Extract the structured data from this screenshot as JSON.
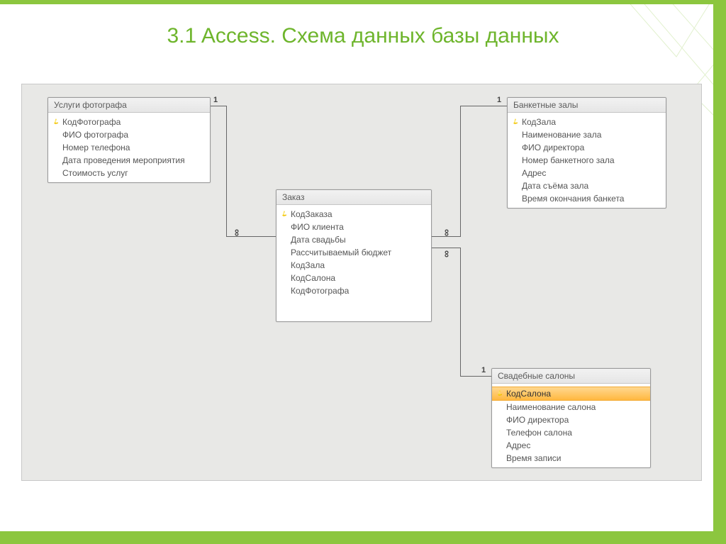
{
  "page_title": "3.1 Access. Схема данных базы данных",
  "tables": {
    "photog": {
      "title": "Услуги фотографа",
      "fields": [
        {
          "label": "КодФотографа",
          "pk": true
        },
        {
          "label": "ФИО фотографа"
        },
        {
          "label": "Номер телефона"
        },
        {
          "label": "Дата проведения мероприятия"
        },
        {
          "label": "Стоимость услуг"
        }
      ]
    },
    "order": {
      "title": "Заказ",
      "fields": [
        {
          "label": "КодЗаказа",
          "pk": true
        },
        {
          "label": "ФИО клиента"
        },
        {
          "label": "Дата свадьбы"
        },
        {
          "label": "Рассчитываемый бюджет"
        },
        {
          "label": "КодЗала"
        },
        {
          "label": "КодСалона"
        },
        {
          "label": "КодФотографа"
        }
      ]
    },
    "halls": {
      "title": "Банкетные залы",
      "fields": [
        {
          "label": "КодЗала",
          "pk": true
        },
        {
          "label": "Наименование зала"
        },
        {
          "label": "ФИО директора"
        },
        {
          "label": "Номер банкетного зала"
        },
        {
          "label": "Адрес"
        },
        {
          "label": "Дата съёма зала"
        },
        {
          "label": "Время окончания банкета"
        }
      ]
    },
    "salons": {
      "title": "Свадебные салоны",
      "fields": [
        {
          "label": "КодСалона",
          "pk": true,
          "selected": true
        },
        {
          "label": "Наименование салона"
        },
        {
          "label": "ФИО директора"
        },
        {
          "label": "Телефон салона"
        },
        {
          "label": "Адрес"
        },
        {
          "label": "Время записи"
        }
      ]
    }
  },
  "rel_labels": {
    "one": "1",
    "inf": "∞"
  }
}
